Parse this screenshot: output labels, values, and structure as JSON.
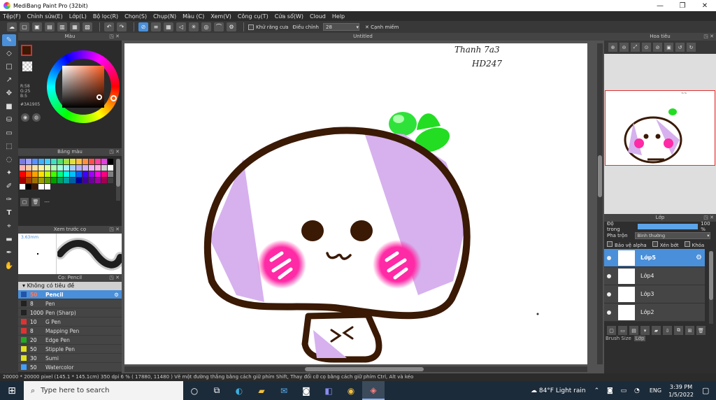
{
  "window": {
    "title": "MediBang Paint Pro (32bit)",
    "min": "—",
    "max": "❐",
    "close": "✕"
  },
  "menu": [
    "Tệp(F)",
    "Chỉnh sửa(E)",
    "Lớp(L)",
    "Bộ lọc(R)",
    "Chọn(S)",
    "Chụp(N)",
    "Màu (C)",
    "Xem(V)",
    "Công cụ(T)",
    "Cửa sổ(W)",
    "Cloud",
    "Help"
  ],
  "toolbar": {
    "antialias_label": "Khử răng cưa",
    "correction_label": "Điều chỉnh",
    "correction_value": "28",
    "snap_label": "Cạnh miếm"
  },
  "color_panel": {
    "title": "Màu",
    "r": "R:58",
    "g": "G:25",
    "b": "B:5",
    "hex": "#3A1905",
    "fg_color": "#3A1905"
  },
  "palette_panel": {
    "title": "Bảng màu",
    "dashes": "---",
    "colors": [
      "#7a7ae0",
      "#a0a0ff",
      "#5a90ff",
      "#40b0ff",
      "#40d0ff",
      "#40e0c0",
      "#50e070",
      "#a0e040",
      "#e0e040",
      "#ffc040",
      "#ff9040",
      "#ff5050",
      "#ff40a0",
      "#e040e0",
      "#000000",
      "#ffb0b0",
      "#ffc8a0",
      "#ffe0a0",
      "#fff0a0",
      "#e0ffa0",
      "#b0ffb0",
      "#a0ffe0",
      "#a0f0ff",
      "#a0d0ff",
      "#b0b0ff",
      "#d0b0ff",
      "#f0b0ff",
      "#ffb0e0",
      "#d0d0d0",
      "#ffffff",
      "#ff0000",
      "#ff6000",
      "#ffa000",
      "#ffe000",
      "#c0ff00",
      "#40ff00",
      "#00ff80",
      "#00ffe0",
      "#00c0ff",
      "#0060ff",
      "#4000ff",
      "#a000ff",
      "#ff00e0",
      "#ff0080",
      "#808080",
      "#a00000",
      "#a04000",
      "#a07000",
      "#a0a000",
      "#60a000",
      "#00a000",
      "#00a060",
      "#00a0a0",
      "#0060a0",
      "#0000a0",
      "#4000a0",
      "#7000a0",
      "#a000a0",
      "#a00050",
      "#404040",
      "#ffffff",
      "#000000",
      "#3A1905",
      "#ffffff",
      "#ffffff"
    ]
  },
  "brush_preview": {
    "title": "Xem trước cọ",
    "size": "3.63mm"
  },
  "brush_panel": {
    "title": "Cọ: Pencil",
    "group": "Không có tiêu đề",
    "items": [
      {
        "num": "50",
        "name": "Pencil",
        "color": "#2255aa",
        "active": true
      },
      {
        "num": "8",
        "name": "Pen",
        "color": "#222222"
      },
      {
        "num": "1000",
        "name": "Pen (Sharp)",
        "color": "#222222"
      },
      {
        "num": "10",
        "name": "G Pen",
        "color": "#dd3333"
      },
      {
        "num": "8",
        "name": "Mapping Pen",
        "color": "#dd3333"
      },
      {
        "num": "20",
        "name": "Edge Pen",
        "color": "#22aa22"
      },
      {
        "num": "50",
        "name": "Stipple Pen",
        "color": "#e0e020"
      },
      {
        "num": "30",
        "name": "Sumi",
        "color": "#e0e020"
      },
      {
        "num": "50",
        "name": "Watercolor",
        "color": "#40a0ff"
      }
    ]
  },
  "canvas": {
    "title": "Untitled",
    "signature_line1": "Thanh 7a3",
    "signature_line2": "HD247",
    "face_text": "ω",
    "mouth_symbol": "><"
  },
  "navigator": {
    "title": "Hoa tiêu"
  },
  "layers": {
    "title": "Lớp",
    "opacity_label": "Độ trong",
    "opacity_value": "100 %",
    "opacity_fill": 1.0,
    "blend_label": "Pha trộn",
    "blend_value": "Bình thường",
    "protect_alpha": "Bảo vệ alpha",
    "clipping": "Xén bớt",
    "lock": "Khóa",
    "items": [
      {
        "name": "Lớp5",
        "active": true
      },
      {
        "name": "Lớp4"
      },
      {
        "name": "Lớp3"
      },
      {
        "name": "Lớp2"
      }
    ],
    "tab_brush_size": "Brush Size",
    "tab_layer": "Lớp"
  },
  "status": "20000 * 20000 pixel   (145.1 * 145.1cm)   350 dpi    6 %    ( 17880, 11480 )   Vẽ một đường thẳng bằng cách giữ phím Shift, Thay đổi cỡ cọ bằng cách giữ phím Ctrl, Alt và kéo",
  "taskbar": {
    "search_placeholder": "Type here to search",
    "weather": "84°F  Light rain",
    "lang": "ENG",
    "time": "3:39 PM",
    "date": "1/5/2022"
  }
}
